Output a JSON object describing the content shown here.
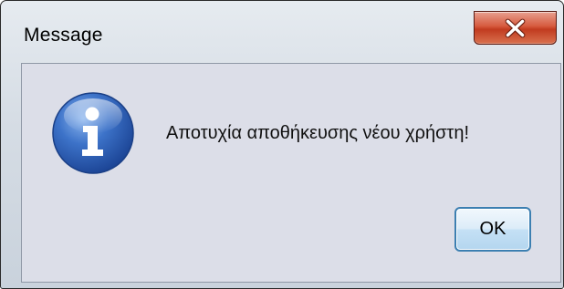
{
  "window": {
    "title": "Message",
    "close_icon": "close-icon"
  },
  "dialog": {
    "icon": "information-icon",
    "message": "Αποτυχία αποθήκευσης νέου χρήστη!",
    "ok_label": "OK"
  },
  "colors": {
    "close_button": "#c9462a",
    "client_background": "#dcdee8",
    "info_icon_blue": "#2a5fb4",
    "ok_border": "#3c7fb1"
  }
}
